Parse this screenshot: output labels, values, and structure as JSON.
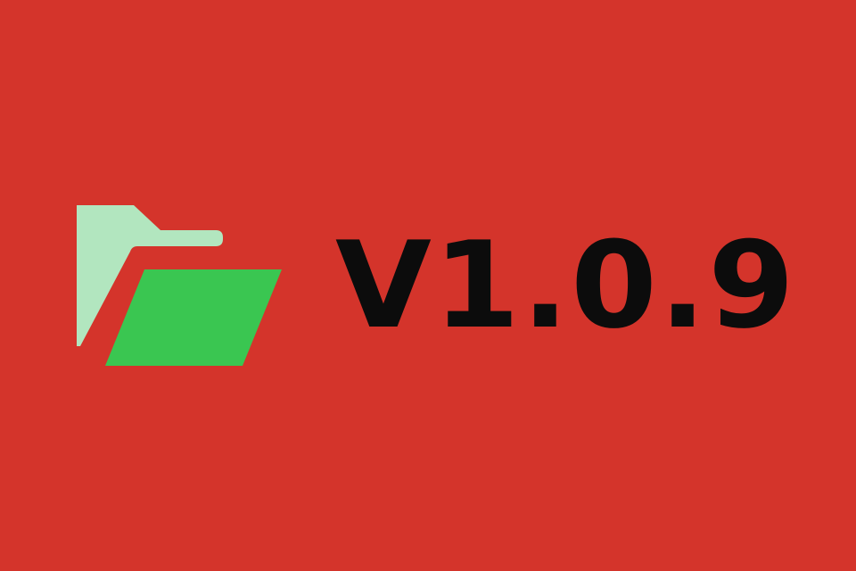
{
  "banner": {
    "background_color": "#d4342b",
    "icon": {
      "name": "open-folder-icon",
      "back_color": "#b2e6bf",
      "front_color": "#3ac651"
    },
    "version_text": "V1.0.9",
    "text_color": "#0c0c0c"
  }
}
